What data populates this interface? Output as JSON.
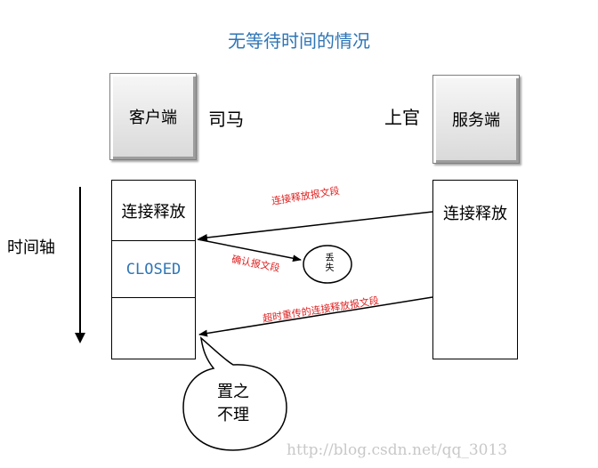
{
  "title": "无等待时间的情况",
  "client": {
    "box_label": "客户端",
    "name": "司马"
  },
  "server": {
    "box_label": "服务端",
    "name": "上官"
  },
  "axis_label": "时间轴",
  "client_states": [
    "连接释放",
    "CLOSED",
    ""
  ],
  "server_state": "连接释放",
  "messages": {
    "release": "连接释放报文段",
    "ack": "确认报文段",
    "retransmit": "超时重传的连接释放报文段"
  },
  "lost_label": "丢失",
  "bubble": {
    "line1": "置之",
    "line2": "不理"
  },
  "watermark": "http://blog.csdn.net/qq_3013"
}
